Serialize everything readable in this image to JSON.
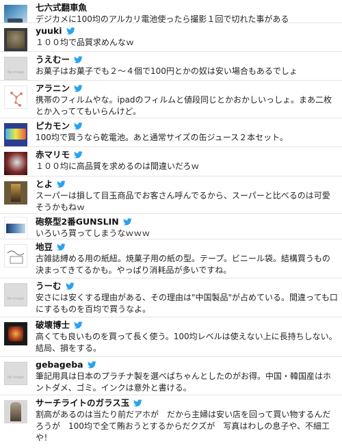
{
  "colors": {
    "bird": "#2aa3ef",
    "divider": "#e3e3e3",
    "name": "#111111",
    "text": "#222222"
  },
  "tweets": [
    {
      "avatar": "landscape-photo-avatar",
      "name": "七六式翻車魚",
      "text": "デジカメに100均のアルカリ電池使ったら撮影１回で切れた事がある"
    },
    {
      "avatar": "dark-figure-avatar",
      "name": "yuuki",
      "text": "１００均で品質求めんなｗ"
    },
    {
      "avatar": "no-image-avatar",
      "name": "うえむー",
      "text": "お菓子はお菓子でも２～４個で100円とかの奴は安い場合もあるでしょ"
    },
    {
      "avatar": "molecule-avatar",
      "name": "アラニン",
      "text": "携帯のフィルムやな。ipadのフィルムと値段同じとかおかしいっしょ。まあ二枚とか入っててもいらんけど。"
    },
    {
      "avatar": "logo-avatar",
      "name": "ピカモン",
      "text": "100均で買うなら乾電池。あと通常サイズの缶ジュース２本セット。"
    },
    {
      "avatar": "red-character-avatar",
      "name": "赤マリモ",
      "text": "１００均に高品質を求めるのは間違いだろｗ"
    },
    {
      "avatar": "figure-photo-avatar",
      "name": "とよ",
      "text": "スーパーは損して目玉商品でお客さん呼んでるから、スーパーと比べるのは可愛そうかもねｗ"
    },
    {
      "avatar": "ship-avatar",
      "name": "砲祭型2番GUNSLIN",
      "text": "いろいろ買ってしまうなｗｗｗ"
    },
    {
      "avatar": "sketch-avatar",
      "name": "地豆",
      "text": "古雑誌縛める用の紙紐。焼菓子用の紙の型。テープ。ビニール袋。結構買うもの決まってきてるかも。やっぱり消耗品が多いですね。"
    },
    {
      "avatar": "no-image-avatar",
      "name": "うーむ",
      "text": "安さには安くする理由がある、その理由は\"中国製品\"が占めている。間違っても口にするものを百均で買うなよ。"
    },
    {
      "avatar": "anime-avatar",
      "name": "破壊博士",
      "text": "高くても良いものを買って長く使う。100均レベルは使えない上に長持ちしない。結局、損をする。"
    },
    {
      "avatar": "no-image-avatar",
      "name": "gebageba",
      "text": "筆記用具は日本のプラチナ製を選べばちゃんとしたのがお得。中国・韓国産はホントダメ、ゴミ。インクは意外と書ける。"
    },
    {
      "avatar": "portrait-avatar",
      "name": "サーチライトのガラス玉",
      "text": "割高があるのは当たり前だアホが　だから主婦は安い店を回って買い物するんだろうが　100均で全て賄おうとするからだクズが　写真はわしの息子や、不細工や！"
    }
  ]
}
